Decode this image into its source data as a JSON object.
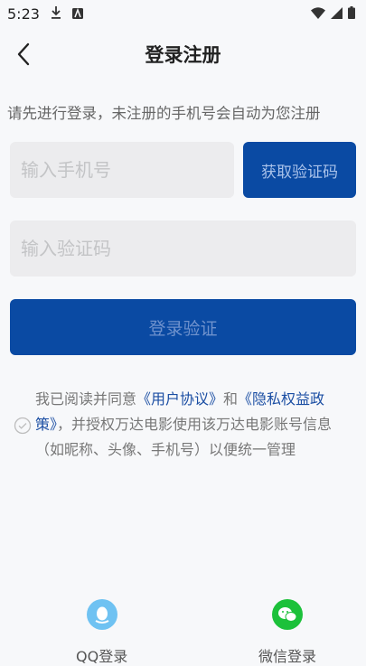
{
  "status": {
    "time": "5:23"
  },
  "nav": {
    "title": "登录注册"
  },
  "hint": "请先进行登录，未注册的手机号会自动为您注册",
  "phone": {
    "placeholder": "输入手机号"
  },
  "get_code_label": "获取验证码",
  "code": {
    "placeholder": "输入验证码"
  },
  "login_label": "登录验证",
  "agreement": {
    "prefix": "我已阅读并同意",
    "user_agreement": "《用户协议》",
    "and": "和",
    "privacy_policy": "《隐私权益政策》",
    "suffix": "，并授权万达电影使用该万达电影账号信息（如昵称、头像、手机号）以便统一管理"
  },
  "social": [
    {
      "label": "QQ登录",
      "icon": "qq-icon"
    },
    {
      "label": "微信登录",
      "icon": "wechat-icon"
    }
  ],
  "colors": {
    "primary": "#0a4aa3",
    "link": "#1b4ea3",
    "qq": "#6fc2f2",
    "wechat": "#1cc13a"
  }
}
